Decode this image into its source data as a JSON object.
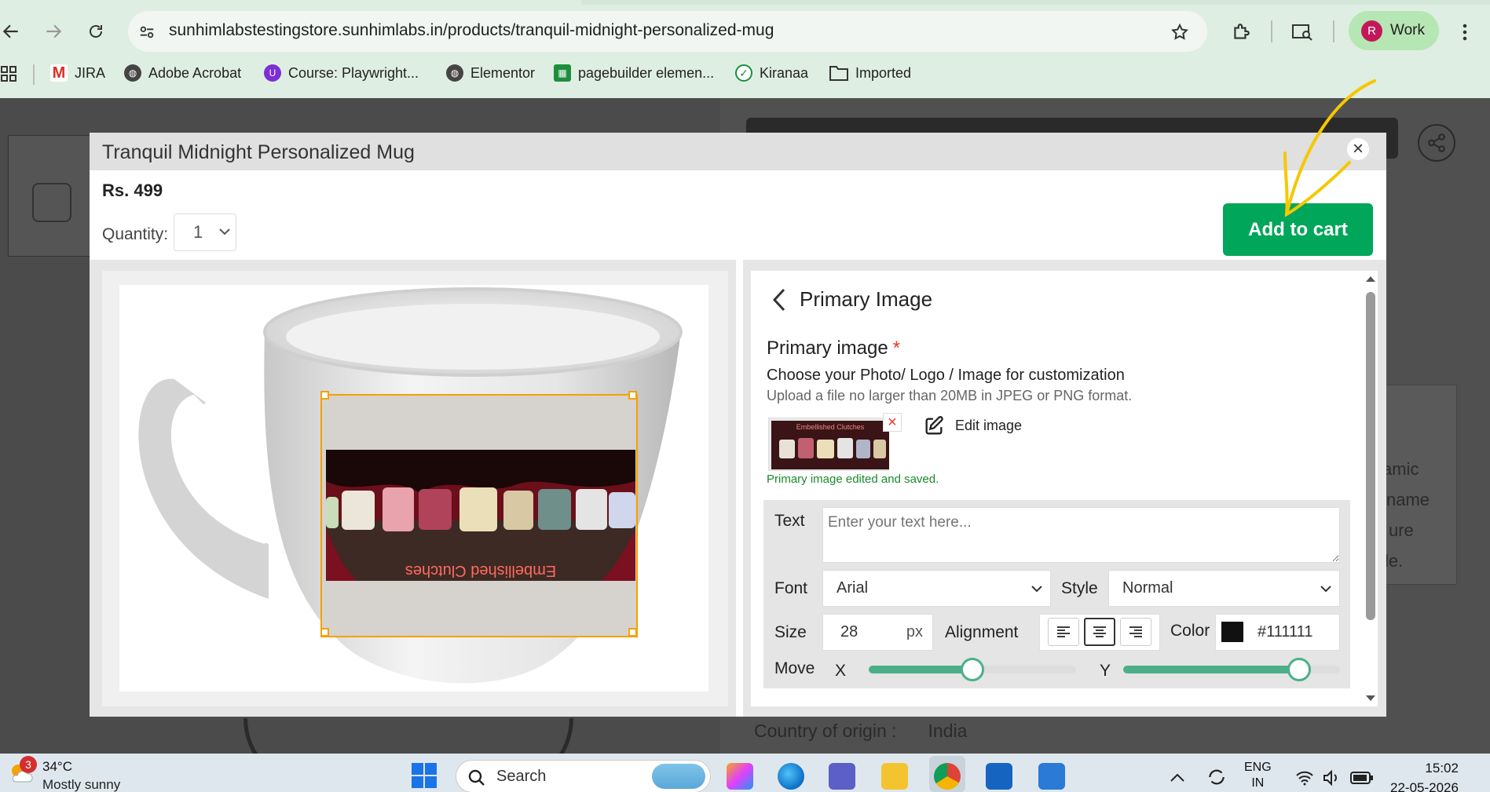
{
  "browser": {
    "url": "sunhimlabstestingstore.sunhimlabs.in/products/tranquil-midnight-personalized-mug",
    "profile_initial": "R",
    "profile_name": "Work",
    "bookmarks": [
      "JIRA",
      "Adobe Acrobat",
      "Course: Playwright...",
      "Elementor",
      "pagebuilder elemen...",
      "Kiranaa",
      "Imported"
    ]
  },
  "background_page": {
    "side_text": [
      "amic",
      "name",
      "ure",
      "le."
    ],
    "origin_label": "Country of origin :",
    "origin_value": "India"
  },
  "modal": {
    "title": "Tranquil Midnight Personalized Mug",
    "price": "Rs. 499",
    "quantity_label": "Quantity:",
    "quantity_value": "1",
    "add_to_cart": "Add to cart",
    "close_symbol": "×"
  },
  "preview": {
    "photo_caption": "Embellished Clutches"
  },
  "panel": {
    "title": "Primary Image",
    "field_label": "Primary image",
    "required_mark": "*",
    "instruction": "Choose your Photo/ Logo / Image for customization",
    "upload_hint": "Upload a file no larger than 20MB in JPEG or PNG format.",
    "thumb_caption": "Embellished Clutches",
    "remove_symbol": "×",
    "edit_label": "Edit image",
    "saved_message": "Primary image edited and saved.",
    "text_label": "Text",
    "text_placeholder": "Enter your text here...",
    "font_label": "Font",
    "font_value": "Arial",
    "style_label": "Style",
    "style_value": "Normal",
    "size_label": "Size",
    "size_value": "28",
    "size_unit": "px",
    "alignment_label": "Alignment",
    "alignment_selected": "center",
    "color_label": "Color",
    "color_value": "#111111",
    "move_label": "Move",
    "x_label": "X",
    "y_label": "Y",
    "x_slider_fraction": 0.5,
    "y_slider_fraction": 0.81
  },
  "taskbar": {
    "weather_badge": "3",
    "temperature": "34°C",
    "weather": "Mostly sunny",
    "search_label": "Search",
    "lang_line1": "ENG",
    "lang_line2": "IN",
    "time": "15:02",
    "date": "22-05-2026"
  },
  "colors": {
    "accent_green": "#00a65a",
    "slider_green": "#4caf88",
    "selection_orange": "#f5a000",
    "saved_green": "#1a8a2a",
    "annotation_yellow": "#f5c800"
  }
}
